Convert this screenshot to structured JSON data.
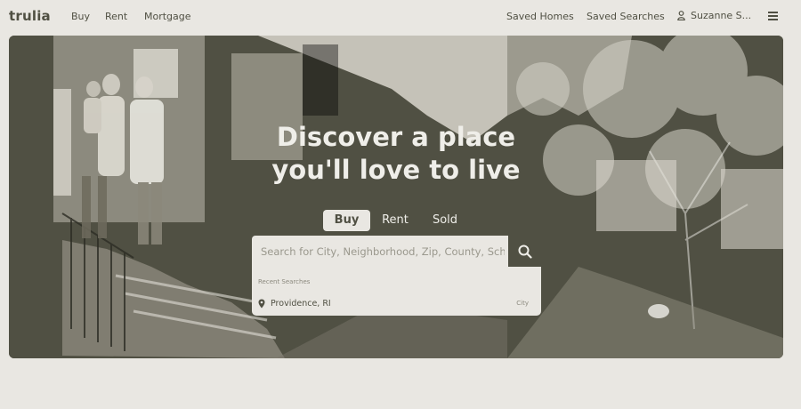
{
  "nav": {
    "logo": "trulia",
    "links": [
      "Buy",
      "Rent",
      "Mortgage"
    ],
    "saved_homes": "Saved Homes",
    "saved_searches": "Saved Searches",
    "user_name": "Suzanne S..."
  },
  "hero": {
    "headline_line1": "Discover a place",
    "headline_line2": "you'll love to live",
    "tabs": [
      "Buy",
      "Rent",
      "Sold"
    ],
    "active_tab": "Buy"
  },
  "search": {
    "placeholder": "Search for City, Neighborhood, Zip, County, School",
    "recent_label": "Recent Searches",
    "recent_items": [
      {
        "city": "Providence, RI",
        "type": "City"
      }
    ]
  },
  "colors": {
    "ink": "#505043",
    "paper": "#e9e7e2",
    "light_text": "#efeee9"
  },
  "icons": [
    "user-icon",
    "menu-icon",
    "search-icon",
    "location-pin-icon"
  ]
}
